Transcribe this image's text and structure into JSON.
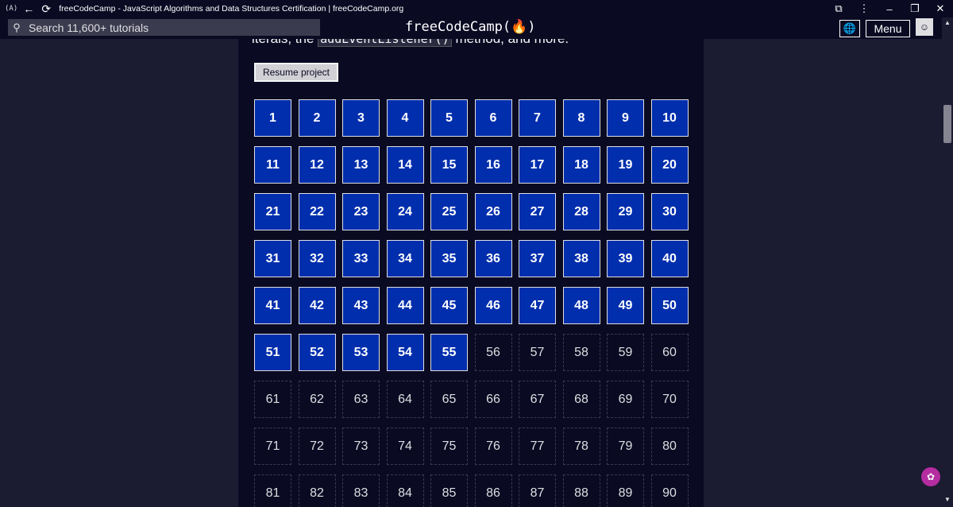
{
  "window": {
    "logo": "(A)",
    "title": "freeCodeCamp - JavaScript Algorithms and Data Structures Certification | freeCodeCamp.org",
    "back_icon": "back-arrow-icon",
    "reload_icon": "reload-icon"
  },
  "navbar": {
    "search_placeholder": "Search 11,600+ tutorials",
    "brand": "freeCodeCamp(🔥)",
    "menu_label": "Menu",
    "language_icon": "globe-icon"
  },
  "content": {
    "cut_text_before": "iterals, the ",
    "cut_text_code": "addEventListener()",
    "cut_text_after": " method, and more.",
    "resume_label": "Resume project"
  },
  "steps": {
    "total": 90,
    "completed": 55,
    "labels": [
      "1",
      "2",
      "3",
      "4",
      "5",
      "6",
      "7",
      "8",
      "9",
      "10",
      "11",
      "12",
      "13",
      "14",
      "15",
      "16",
      "17",
      "18",
      "19",
      "20",
      "21",
      "22",
      "23",
      "24",
      "25",
      "26",
      "27",
      "28",
      "29",
      "30",
      "31",
      "32",
      "33",
      "34",
      "35",
      "36",
      "37",
      "38",
      "39",
      "40",
      "41",
      "42",
      "43",
      "44",
      "45",
      "46",
      "47",
      "48",
      "49",
      "50",
      "51",
      "52",
      "53",
      "54",
      "55",
      "56",
      "57",
      "58",
      "59",
      "60",
      "61",
      "62",
      "63",
      "64",
      "65",
      "66",
      "67",
      "68",
      "69",
      "70",
      "71",
      "72",
      "73",
      "74",
      "75",
      "76",
      "77",
      "78",
      "79",
      "80",
      "81",
      "82",
      "83",
      "84",
      "85",
      "86",
      "87",
      "88",
      "89",
      "90"
    ]
  },
  "colors": {
    "completed_bg": "#002ead",
    "page_bg": "#1b1b32",
    "panel_bg": "#0a0a23"
  }
}
